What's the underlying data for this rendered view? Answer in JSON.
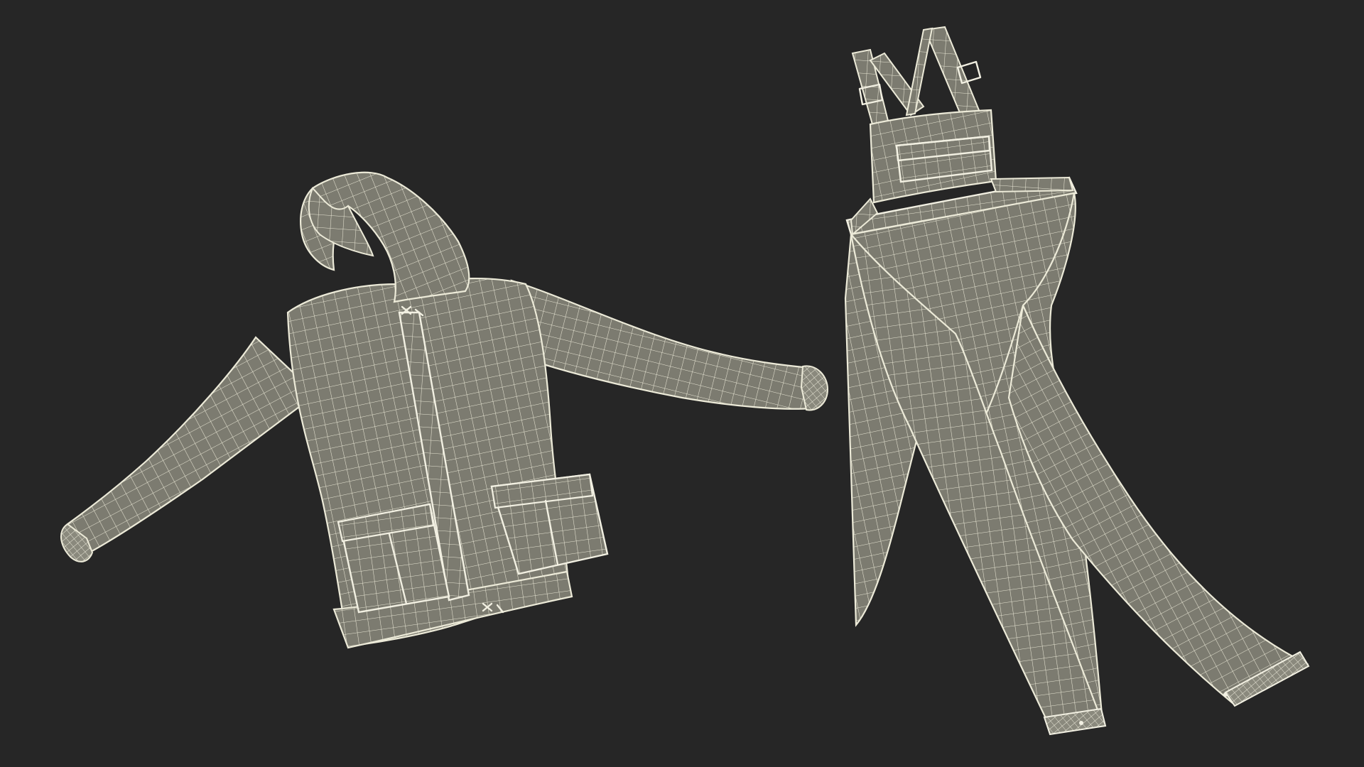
{
  "scene": {
    "background_color": "#262626",
    "fabric_color": "#7c7b70",
    "wire_color": "#e8e6d4"
  },
  "objects": [
    {
      "name": "hooded-jacket",
      "icon": "jacket-wireframe"
    },
    {
      "name": "bib-overalls",
      "icon": "overalls-wireframe"
    }
  ]
}
